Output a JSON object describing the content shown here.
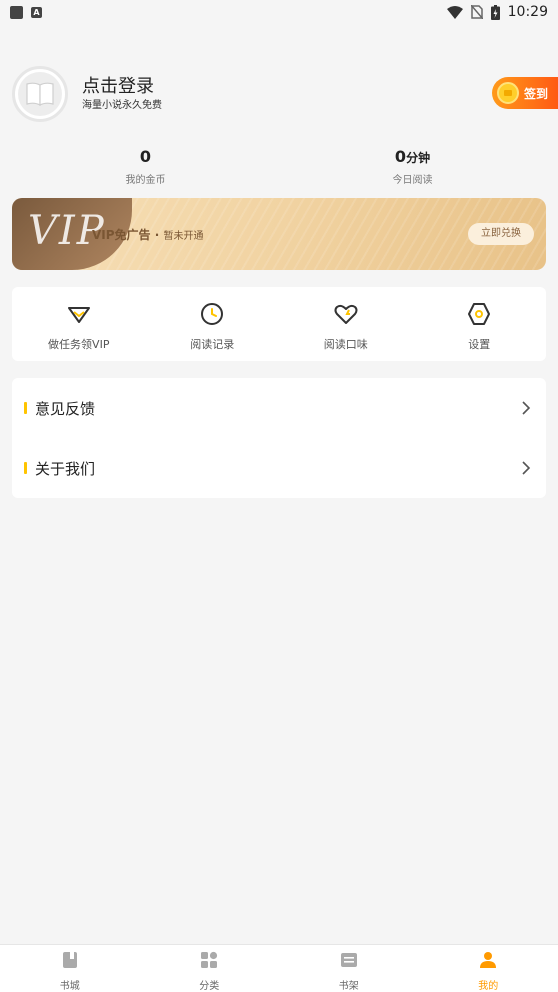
{
  "status_bar": {
    "time": "10:29",
    "left_icons": [
      "square-icon",
      "a-icon"
    ],
    "right_icons": [
      "wifi-icon",
      "no-sim-icon",
      "battery-charging-icon"
    ]
  },
  "profile": {
    "title": "点击登录",
    "subtitle": "海量小说永久免费",
    "signin_label": "签到"
  },
  "stats": [
    {
      "value": "0",
      "unit": "",
      "label": "我的金币"
    },
    {
      "value": "0",
      "unit": "分钟",
      "label": "今日阅读"
    }
  ],
  "vip_banner": {
    "big_text": "VIP",
    "text": "VIP免广告",
    "separator": "·",
    "status": "暂未开通",
    "button_label": "立即兑换"
  },
  "quick_menu": [
    {
      "label": "做任务领VIP",
      "icon": "diamond-icon"
    },
    {
      "label": "阅读记录",
      "icon": "clock-icon"
    },
    {
      "label": "阅读口味",
      "icon": "heart-icon"
    },
    {
      "label": "设置",
      "icon": "settings-hexagon-icon"
    }
  ],
  "list_items": [
    {
      "label": "意见反馈"
    },
    {
      "label": "关于我们"
    }
  ],
  "bottom_nav": [
    {
      "label": "书城",
      "icon": "book-icon",
      "active": false
    },
    {
      "label": "分类",
      "icon": "grid-icon",
      "active": false
    },
    {
      "label": "书架",
      "icon": "bookshelf-icon",
      "active": false
    },
    {
      "label": "我的",
      "icon": "user-icon",
      "active": true
    }
  ],
  "colors": {
    "accent": "#ff9a00",
    "signin_start": "#ff9a1a",
    "signin_end": "#ff5a14",
    "list_marker": "#ffc400",
    "vip_gold": "#f1d3a2"
  }
}
